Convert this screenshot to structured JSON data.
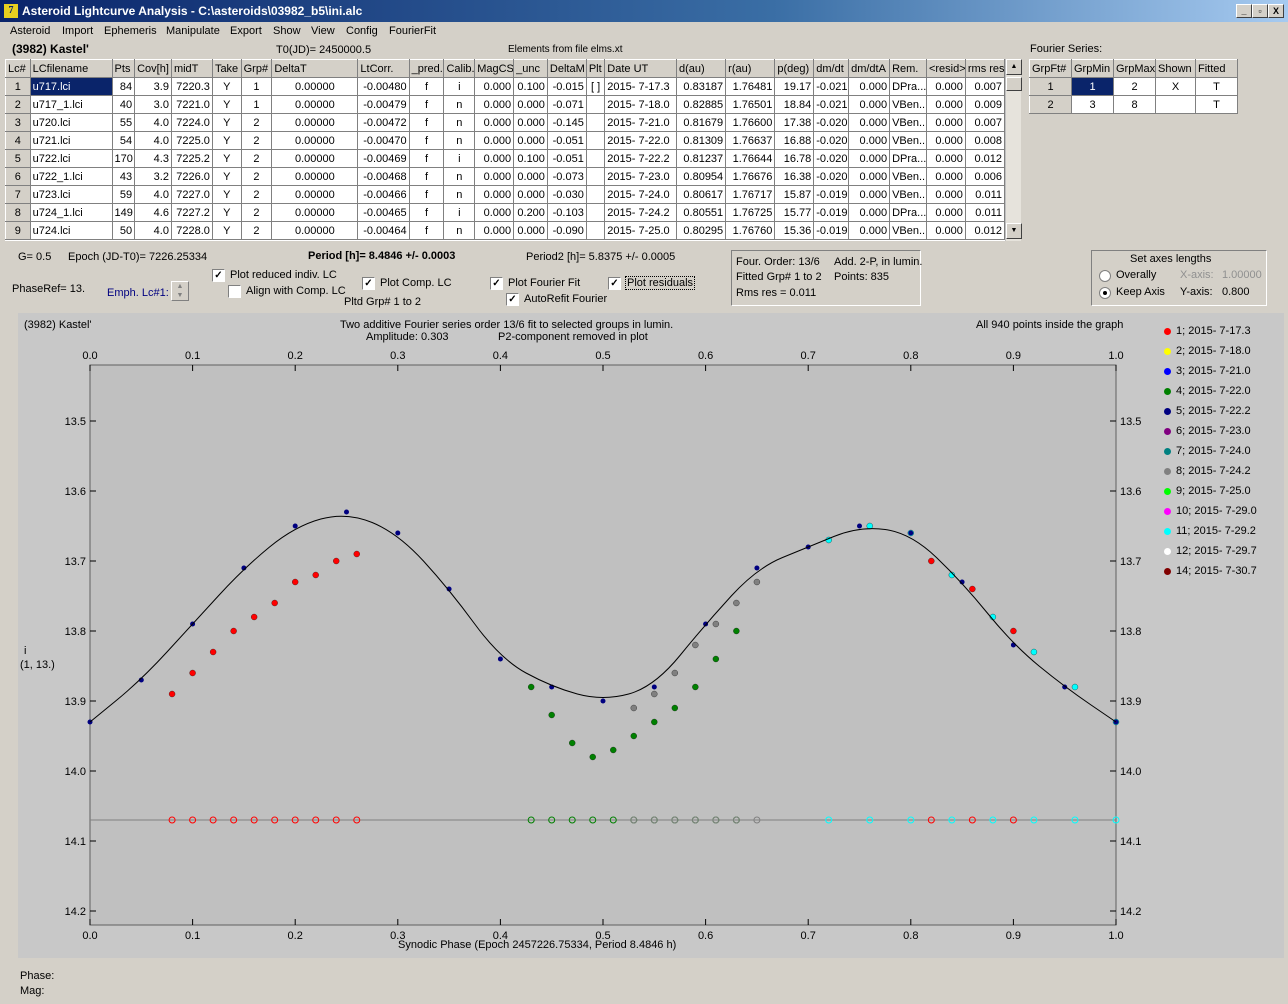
{
  "window": {
    "title": "Asteroid Lightcurve Analysis - C:\\asteroids\\03982_b5\\ini.alc",
    "btn_min": "_",
    "btn_max": "▫",
    "btn_close": "X"
  },
  "menu": [
    "Asteroid",
    "Import",
    "Ephemeris",
    "Manipulate",
    "Export",
    "Show",
    "View",
    "Config",
    "FourierFit"
  ],
  "header": {
    "asteroid": "(3982) Kastel'",
    "t0": "T0(JD)= 2450000.5",
    "elements": "Elements from file elms.xt",
    "fourier_title": "Fourier Series:"
  },
  "lc_table": {
    "columns": [
      "Lc#",
      "LCfilename",
      "Pts",
      "Cov[h]",
      "midT",
      "Take",
      "Grp#",
      "DeltaT",
      "LtCorr.",
      "_pred.",
      "Calib.",
      "MagCS",
      "_unc",
      "DeltaM",
      "Plt",
      "Date UT",
      "d(au)",
      "r(au)",
      "p(deg)",
      "dm/dt",
      "dm/dtA",
      "Rem.",
      "<resid>",
      "rms res"
    ],
    "rows": [
      [
        "1",
        "u717.lci",
        "84",
        "3.9",
        "7220.3",
        "Y",
        "1",
        "0.00000",
        "-0.00480",
        "f",
        "i",
        "0.000",
        "0.100",
        "-0.015",
        "[ ]",
        "2015- 7-17.3",
        "0.83187",
        "1.76481",
        "19.17",
        "-0.021",
        "0.000",
        "DPra...",
        "0.000",
        "0.007"
      ],
      [
        "2",
        "u717_1.lci",
        "40",
        "3.0",
        "7221.0",
        "Y",
        "1",
        "0.00000",
        "-0.00479",
        "f",
        "n",
        "0.000",
        "0.000",
        "-0.071",
        "",
        "2015- 7-18.0",
        "0.82885",
        "1.76501",
        "18.84",
        "-0.021",
        "0.000",
        "VBen...",
        "0.000",
        "0.009"
      ],
      [
        "3",
        "u720.lci",
        "55",
        "4.0",
        "7224.0",
        "Y",
        "2",
        "0.00000",
        "-0.00472",
        "f",
        "n",
        "0.000",
        "0.000",
        "-0.145",
        "",
        "2015- 7-21.0",
        "0.81679",
        "1.76600",
        "17.38",
        "-0.020",
        "0.000",
        "VBen...",
        "0.000",
        "0.007"
      ],
      [
        "4",
        "u721.lci",
        "54",
        "4.0",
        "7225.0",
        "Y",
        "2",
        "0.00000",
        "-0.00470",
        "f",
        "n",
        "0.000",
        "0.000",
        "-0.051",
        "",
        "2015- 7-22.0",
        "0.81309",
        "1.76637",
        "16.88",
        "-0.020",
        "0.000",
        "VBen...",
        "0.000",
        "0.008"
      ],
      [
        "5",
        "u722.lci",
        "170",
        "4.3",
        "7225.2",
        "Y",
        "2",
        "0.00000",
        "-0.00469",
        "f",
        "i",
        "0.000",
        "0.100",
        "-0.051",
        "",
        "2015- 7-22.2",
        "0.81237",
        "1.76644",
        "16.78",
        "-0.020",
        "0.000",
        "DPra...",
        "0.000",
        "0.012"
      ],
      [
        "6",
        "u722_1.lci",
        "43",
        "3.2",
        "7226.0",
        "Y",
        "2",
        "0.00000",
        "-0.00468",
        "f",
        "n",
        "0.000",
        "0.000",
        "-0.073",
        "",
        "2015- 7-23.0",
        "0.80954",
        "1.76676",
        "16.38",
        "-0.020",
        "0.000",
        "VBen...",
        "0.000",
        "0.006"
      ],
      [
        "7",
        "u723.lci",
        "59",
        "4.0",
        "7227.0",
        "Y",
        "2",
        "0.00000",
        "-0.00466",
        "f",
        "n",
        "0.000",
        "0.000",
        "-0.030",
        "",
        "2015- 7-24.0",
        "0.80617",
        "1.76717",
        "15.87",
        "-0.019",
        "0.000",
        "VBen...",
        "0.000",
        "0.011"
      ],
      [
        "8",
        "u724_1.lci",
        "149",
        "4.6",
        "7227.2",
        "Y",
        "2",
        "0.00000",
        "-0.00465",
        "f",
        "i",
        "0.000",
        "0.200",
        "-0.103",
        "",
        "2015- 7-24.2",
        "0.80551",
        "1.76725",
        "15.77",
        "-0.019",
        "0.000",
        "DPra...",
        "0.000",
        "0.011"
      ],
      [
        "9",
        "u724.lci",
        "50",
        "4.0",
        "7228.0",
        "Y",
        "2",
        "0.00000",
        "-0.00464",
        "f",
        "n",
        "0.000",
        "0.000",
        "-0.090",
        "",
        "2015- 7-25.0",
        "0.80295",
        "1.76760",
        "15.36",
        "-0.019",
        "0.000",
        "VBen...",
        "0.000",
        "0.012"
      ]
    ]
  },
  "fourier_table": {
    "columns": [
      "GrpFt#",
      "GrpMin",
      "GrpMax",
      "Shown",
      "Fitted"
    ],
    "rows": [
      [
        "1",
        "1",
        "2",
        "X",
        "T"
      ],
      [
        "2",
        "3",
        "8",
        "",
        "T"
      ]
    ]
  },
  "controls": {
    "g": "G= 0.5",
    "epoch": "Epoch (JD-T0)= 7226.25334",
    "period": "Period [h]= 8.4846 +/- 0.0003",
    "period2": "Period2 [h]= 5.8375 +/- 0.0005",
    "phaseref": "PhaseRef= 13.",
    "emph": "Emph. Lc#1:",
    "cb_reduced": "Plot reduced indiv. LC",
    "cb_align": "Align with Comp. LC",
    "cb_comp": "Plot Comp. LC",
    "pltd_grp": "Pltd Grp#  1   to   2",
    "cb_fourier": "Plot Fourier Fit",
    "cb_autorefit": "AutoRefit Fourier",
    "cb_resid": "Plot residuals",
    "check_mark": "✓",
    "info1": "Four. Order: 13/6",
    "info2": "Add. 2-P, in lumin.",
    "info3": "Fitted Grp# 1 to 2",
    "info4": "Points: 835",
    "info5": "Rms res      = 0.011",
    "axes_title": "Set axes lengths",
    "rb_overall": "Overally",
    "rb_keep": "Keep Axis",
    "xaxis_lbl": "X-axis:",
    "xaxis_val": "1.00000",
    "yaxis_lbl": "Y-axis:",
    "yaxis_val": "0.800"
  },
  "plot": {
    "name": "(3982) Kastel'",
    "line1": "Two additive Fourier series order 13/6 fit to selected groups in lumin.",
    "line2": "Amplitude: 0.303",
    "line3": "P2-component removed in plot",
    "inside": "All 940 points inside the graph",
    "xlabel": "Synodic Phase (Epoch 2457226.75334, Period 8.4846 h)",
    "ylabel1": "i",
    "ylabel2": "(1, 13.)",
    "phase_lbl": "Phase:",
    "mag_lbl": "Mag:"
  },
  "chart_data": {
    "type": "scatter",
    "xlim": [
      0,
      1
    ],
    "ylim": [
      14.22,
      13.42
    ],
    "xticks": [
      "0.0",
      "0.1",
      "0.2",
      "0.3",
      "0.4",
      "0.5",
      "0.6",
      "0.7",
      "0.8",
      "0.9",
      "1.0"
    ],
    "yticks": [
      "13.5",
      "13.6",
      "13.7",
      "13.8",
      "13.9",
      "14.0",
      "14.1",
      "14.2"
    ],
    "legend": [
      {
        "label": "1; 2015- 7-17.3",
        "color": "#ff0000"
      },
      {
        "label": "2; 2015- 7-18.0",
        "color": "#ffff00"
      },
      {
        "label": "3; 2015- 7-21.0",
        "color": "#0000ff"
      },
      {
        "label": "4; 2015- 7-22.0",
        "color": "#008000"
      },
      {
        "label": "5; 2015- 7-22.2",
        "color": "#000080"
      },
      {
        "label": "6; 2015- 7-23.0",
        "color": "#800080"
      },
      {
        "label": "7; 2015- 7-24.0",
        "color": "#008080"
      },
      {
        "label": "8; 2015- 7-24.2",
        "color": "#808080"
      },
      {
        "label": "9; 2015- 7-25.0",
        "color": "#00ff00"
      },
      {
        "label": "10; 2015- 7-29.0",
        "color": "#ff00ff"
      },
      {
        "label": "11; 2015- 7-29.2",
        "color": "#00ffff"
      },
      {
        "label": "12; 2015- 7-29.7",
        "color": "#ffffff"
      },
      {
        "label": "14; 2015- 7-30.7",
        "color": "#800000"
      }
    ],
    "fit_curve": [
      [
        0.0,
        13.93
      ],
      [
        0.05,
        13.87
      ],
      [
        0.1,
        13.79
      ],
      [
        0.15,
        13.71
      ],
      [
        0.2,
        13.65
      ],
      [
        0.25,
        13.63
      ],
      [
        0.3,
        13.66
      ],
      [
        0.35,
        13.74
      ],
      [
        0.4,
        13.84
      ],
      [
        0.45,
        13.88
      ],
      [
        0.5,
        13.9
      ],
      [
        0.55,
        13.88
      ],
      [
        0.6,
        13.79
      ],
      [
        0.65,
        13.71
      ],
      [
        0.7,
        13.68
      ],
      [
        0.75,
        13.65
      ],
      [
        0.8,
        13.66
      ],
      [
        0.85,
        13.73
      ],
      [
        0.9,
        13.82
      ],
      [
        0.95,
        13.88
      ],
      [
        1.0,
        13.93
      ]
    ],
    "comp_series": [
      {
        "name": "1; 2015- 7-17.3",
        "color": "#ff0000",
        "points": [
          [
            0.08,
            13.89
          ],
          [
            0.1,
            13.86
          ],
          [
            0.12,
            13.83
          ],
          [
            0.14,
            13.8
          ],
          [
            0.16,
            13.78
          ],
          [
            0.18,
            13.76
          ],
          [
            0.2,
            13.73
          ],
          [
            0.22,
            13.72
          ],
          [
            0.24,
            13.7
          ],
          [
            0.26,
            13.69
          ],
          [
            0.82,
            13.7
          ],
          [
            0.86,
            13.74
          ],
          [
            0.9,
            13.8
          ]
        ]
      },
      {
        "name": "4; 2015- 7-22.0",
        "color": "#008000",
        "points": [
          [
            0.43,
            13.88
          ],
          [
            0.45,
            13.92
          ],
          [
            0.47,
            13.96
          ],
          [
            0.49,
            13.98
          ],
          [
            0.51,
            13.97
          ],
          [
            0.53,
            13.95
          ],
          [
            0.55,
            13.93
          ],
          [
            0.57,
            13.91
          ],
          [
            0.59,
            13.88
          ],
          [
            0.61,
            13.84
          ],
          [
            0.63,
            13.8
          ]
        ]
      },
      {
        "name": "8; 2015- 7-24.2",
        "color": "#808080",
        "points": [
          [
            0.53,
            13.91
          ],
          [
            0.55,
            13.89
          ],
          [
            0.57,
            13.86
          ],
          [
            0.59,
            13.82
          ],
          [
            0.61,
            13.79
          ],
          [
            0.63,
            13.76
          ],
          [
            0.65,
            13.73
          ]
        ]
      },
      {
        "name": "11; 2015- 7-29.2",
        "color": "#00ffff",
        "points": [
          [
            0.72,
            13.67
          ],
          [
            0.76,
            13.65
          ],
          [
            0.8,
            13.66
          ],
          [
            0.84,
            13.72
          ],
          [
            0.88,
            13.78
          ],
          [
            0.92,
            13.83
          ],
          [
            0.96,
            13.88
          ],
          [
            1.0,
            13.93
          ]
        ]
      }
    ],
    "residual_level": 14.07
  }
}
